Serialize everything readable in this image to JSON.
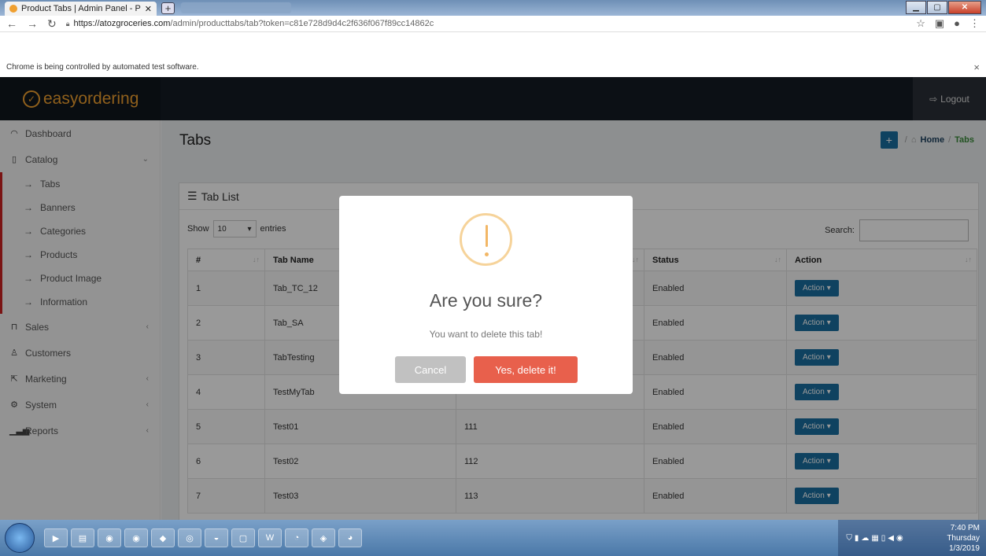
{
  "browser": {
    "tab_title": "Product Tabs | Admin Panel - Po",
    "url_host": "https://atozgroceries.com",
    "url_path": "/admin/producttabs/tab?token=c81e728d9d4c2f636f067f89cc14862c",
    "infobar_text": "Chrome is being controlled by automated test software."
  },
  "header": {
    "logo_text": "easyordering",
    "logout_label": "Logout"
  },
  "sidebar": {
    "items": [
      {
        "label": "Dashboard"
      },
      {
        "label": "Catalog"
      },
      {
        "label": "Sales"
      },
      {
        "label": "Customers"
      },
      {
        "label": "Marketing"
      },
      {
        "label": "System"
      },
      {
        "label": "Reports"
      }
    ],
    "catalog_sub": [
      "Tabs",
      "Banners",
      "Categories",
      "Products",
      "Product Image",
      "Information"
    ]
  },
  "page": {
    "title": "Tabs",
    "crumb_home": "Home",
    "crumb_current": "Tabs",
    "panel_title": "Tab List",
    "show_label": "Show",
    "entries_value": "10",
    "entries_label": "entries",
    "search_label": "Search:"
  },
  "table": {
    "headers": [
      "#",
      "Tab Name",
      "",
      "Status",
      "Action"
    ],
    "action_label": "Action",
    "rows": [
      {
        "id": "1",
        "name": "Tab_TC_12",
        "third": "",
        "status": "Enabled"
      },
      {
        "id": "2",
        "name": "Tab_SA",
        "third": "",
        "status": "Enabled"
      },
      {
        "id": "3",
        "name": "TabTesting",
        "third": "",
        "status": "Enabled"
      },
      {
        "id": "4",
        "name": "TestMyTab",
        "third": "",
        "status": "Enabled"
      },
      {
        "id": "5",
        "name": "Test01",
        "third": "111",
        "status": "Enabled"
      },
      {
        "id": "6",
        "name": "Test02",
        "third": "112",
        "status": "Enabled"
      },
      {
        "id": "7",
        "name": "Test03",
        "third": "113",
        "status": "Enabled"
      }
    ]
  },
  "modal": {
    "question": "Are you sure?",
    "message": "You want to delete this tab!",
    "cancel_label": "Cancel",
    "confirm_label": "Yes, delete it!"
  },
  "taskbar": {
    "time": "7:40 PM",
    "day": "Thursday",
    "date": "1/3/2019"
  },
  "colors": {
    "header_bg": "#141c24",
    "logo_accent": "#f0a030",
    "action_button": "#1a6fa0",
    "confirm_button": "#e8604c",
    "cancel_button": "#c1c1c1",
    "catalog_marker": "#cc2222"
  }
}
